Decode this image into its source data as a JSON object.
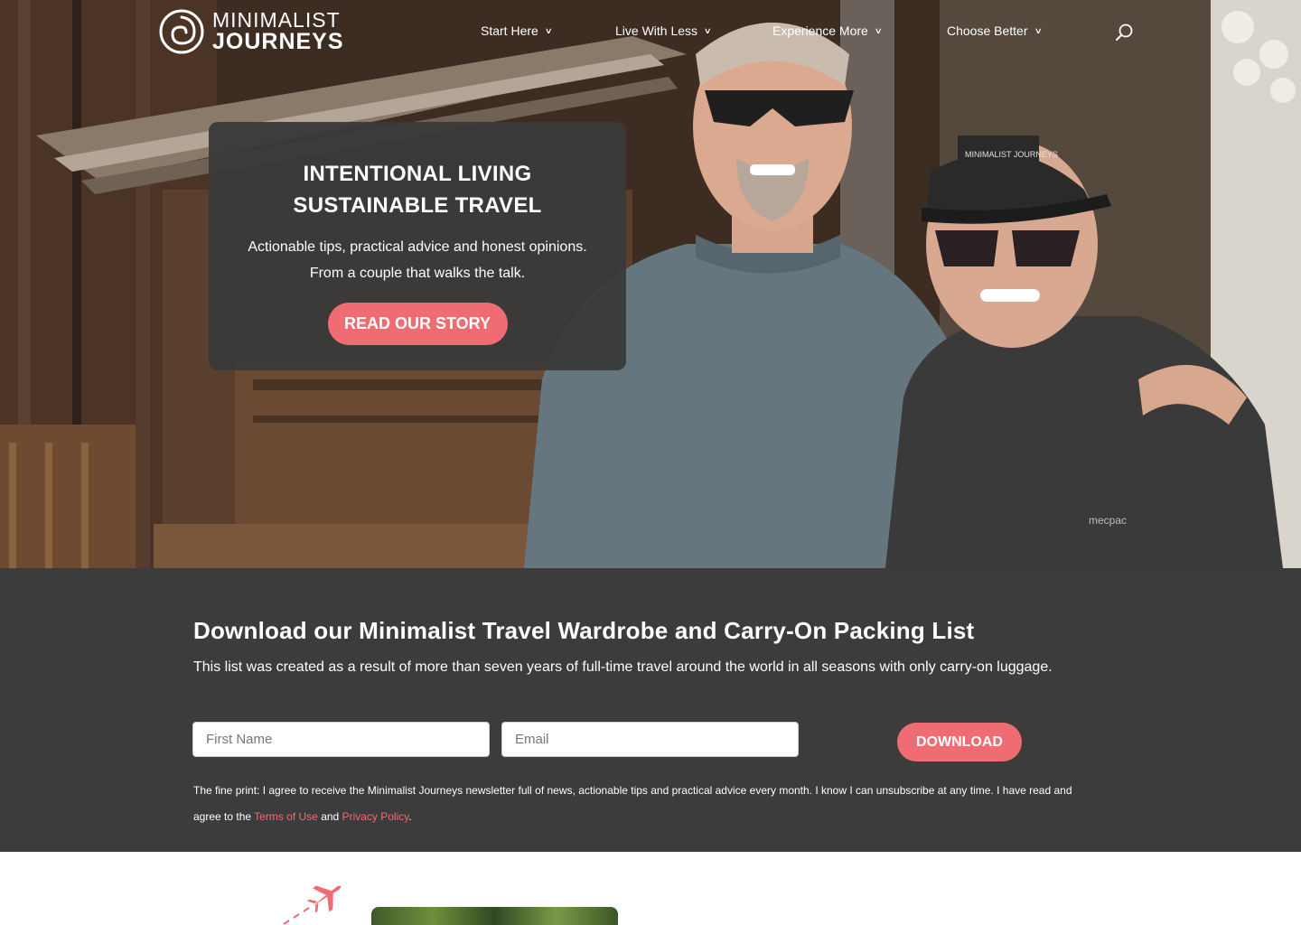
{
  "logo": {
    "line1": "MINIMALIST",
    "line2": "JOURNEYS"
  },
  "nav": [
    {
      "label": "Start Here"
    },
    {
      "label": "Live With Less"
    },
    {
      "label": "Experience More"
    },
    {
      "label": "Choose Better"
    }
  ],
  "hero": {
    "title_line1": "INTENTIONAL LIVING",
    "title_line2": "SUSTAINABLE TRAVEL",
    "sub_line1": "Actionable tips, practical advice and honest opinions.",
    "sub_line2": "From a couple that walks the talk.",
    "button": "READ OUR STORY",
    "cap_text": "MINIMALIST JOURNEYS",
    "jacket_text": "mecpac"
  },
  "optin": {
    "title": "Download our Minimalist Travel Wardrobe and Carry-On Packing List",
    "description": "This list was created as a result of more than seven years of full-time travel around the world in all seasons with only carry-on luggage.",
    "first_name_placeholder": "First Name",
    "email_placeholder": "Email",
    "button": "DOWNLOAD",
    "fine_print_prefix": "The fine print: I agree to receive the Minimalist Journeys newsletter full of news, actionable tips and practical advice every month. I know I can unsubscribe at any time. I have read and agree to the ",
    "terms_link": "Terms of Use",
    "and": " and ",
    "privacy_link": "Privacy Policy",
    "fine_print_suffix": "."
  },
  "colors": {
    "accent": "#f06c73",
    "dark_panel": "#3c3c3c",
    "hero_card": "#3a3a3a"
  },
  "icons": [
    "logo-spiral-icon",
    "chevron-down-icon",
    "search-icon",
    "airplane-icon"
  ]
}
